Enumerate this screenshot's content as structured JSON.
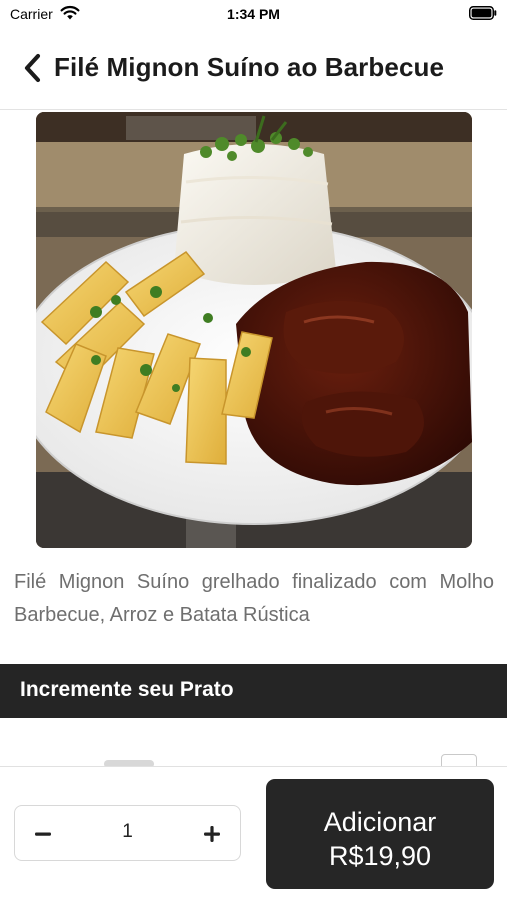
{
  "status_bar": {
    "carrier": "Carrier",
    "time": "1:34 PM",
    "icons": [
      "wifi-icon",
      "battery-icon"
    ]
  },
  "nav": {
    "title": "Filé Mignon Suíno ao Barbecue",
    "back_icon": "chevron-left-icon"
  },
  "product": {
    "photo": "dish-photo",
    "description": "Filé Mignon Suíno grelhado finalizado com Molho Barbecue, Arroz e Batata Rústica"
  },
  "section": {
    "title": "Incremente seu Prato"
  },
  "order": {
    "quantity": "1",
    "minus_icon": "minus-icon",
    "plus_icon": "plus-icon",
    "add_label": "Adicionar",
    "price": "R$19,90"
  },
  "colors": {
    "dark": "#252525",
    "description_text": "#6f6f6f",
    "background": "#ffffff"
  }
}
